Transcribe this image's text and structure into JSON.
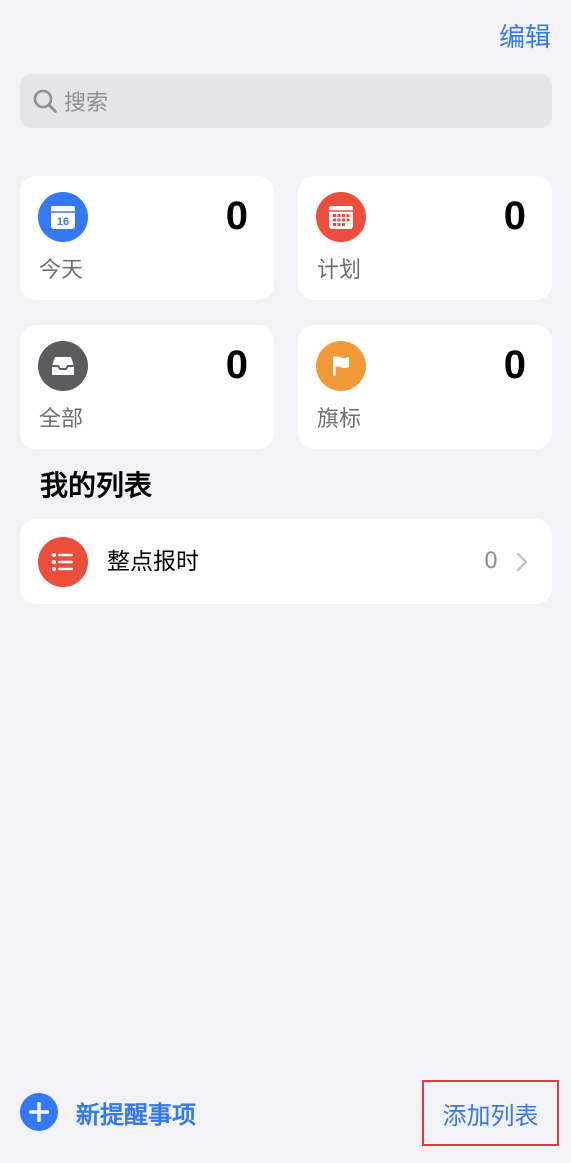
{
  "header": {
    "edit_label": "编辑"
  },
  "search": {
    "placeholder": "搜索"
  },
  "smart_lists": [
    {
      "label": "今天",
      "count": "0",
      "color": "#3478f6",
      "icon": "calendar-today-icon",
      "day": "16"
    },
    {
      "label": "计划",
      "count": "0",
      "color": "#ec4d3d",
      "icon": "calendar-grid-icon"
    },
    {
      "label": "全部",
      "count": "0",
      "color": "#5b5b60",
      "icon": "tray-icon"
    },
    {
      "label": "旗标",
      "count": "0",
      "color": "#f19a37",
      "icon": "flag-icon"
    }
  ],
  "my_lists": {
    "title": "我的列表",
    "items": [
      {
        "name": "整点报时",
        "count": "0",
        "color": "#ec4d3d",
        "icon": "list-bullet-icon"
      }
    ]
  },
  "footer": {
    "new_reminder_label": "新提醒事项",
    "add_list_label": "添加列表",
    "accent": "#3478f6",
    "highlight": "#e03a3a"
  }
}
